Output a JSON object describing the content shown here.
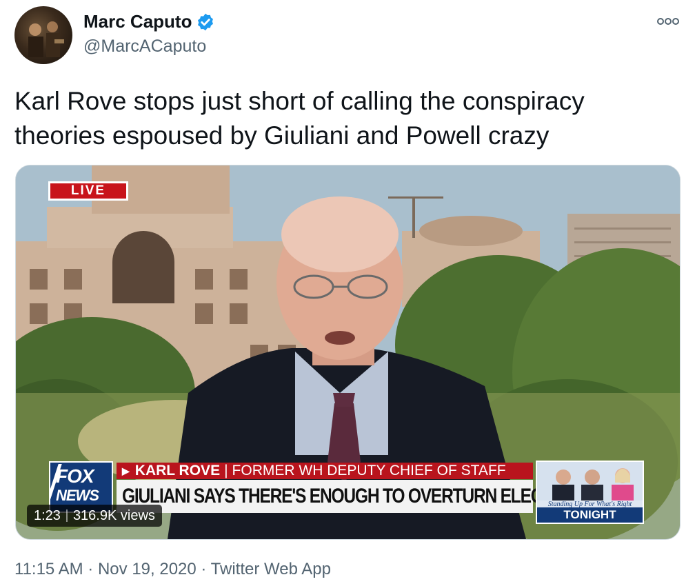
{
  "author": {
    "name": "Marc Caputo",
    "handle": "@MarcACaputo",
    "verified": true,
    "avatar_icon": "profile-photo"
  },
  "more_icon": "more-options-icon",
  "tweet": {
    "text": "Karl Rove stops just short of calling the conspiracy theories espoused by Giuliani and Powell crazy"
  },
  "video": {
    "live_label": "LIVE",
    "network_logo": {
      "line1": "FOX",
      "line2": "NEWS"
    },
    "lower_third": {
      "name": "KARL ROVE",
      "separator": "|",
      "title": "FORMER WH DEPUTY CHIEF OF STAFF",
      "headline": "GIULIANI SAYS THERE'S ENOUGH TO OVERTURN ELECTION"
    },
    "promo": {
      "tagline": "Standing Up For What's Right",
      "label": "TONIGHT"
    },
    "duration": "1:23",
    "views": "316.9K views"
  },
  "footer": {
    "time": "11:15 AM",
    "date": "Nov 19, 2020",
    "source": "Twitter Web App",
    "separator": "·"
  },
  "colors": {
    "text_primary": "#0f1419",
    "text_secondary": "#536471",
    "verified_blue": "#1d9bf0",
    "fox_red": "#b9141d",
    "fox_blue": "#123a78"
  }
}
